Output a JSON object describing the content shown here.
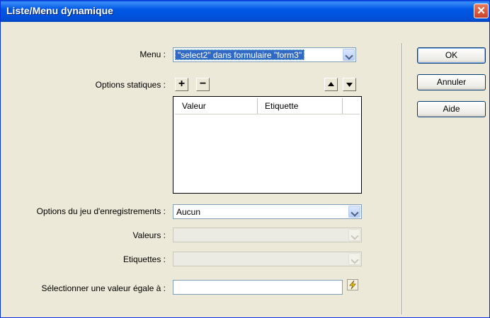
{
  "window": {
    "title": "Liste/Menu dynamique"
  },
  "menu": {
    "label": "Menu :",
    "value": "\"select2\" dans formulaire \"form3\""
  },
  "static_options": {
    "label": "Options statiques :",
    "add_symbol": "+",
    "remove_symbol": "−",
    "columns": [
      "Valeur",
      "Etiquette"
    ]
  },
  "recordset": {
    "label": "Options du jeu d'enregistrements :",
    "value": "Aucun"
  },
  "values": {
    "label": "Valeurs :",
    "value": ""
  },
  "labels": {
    "label": "Etiquettes :",
    "value": ""
  },
  "select_value": {
    "label": "Sélectionner une valeur égale à :",
    "value": ""
  },
  "buttons": {
    "ok": "OK",
    "cancel": "Annuler",
    "help": "Aide"
  }
}
